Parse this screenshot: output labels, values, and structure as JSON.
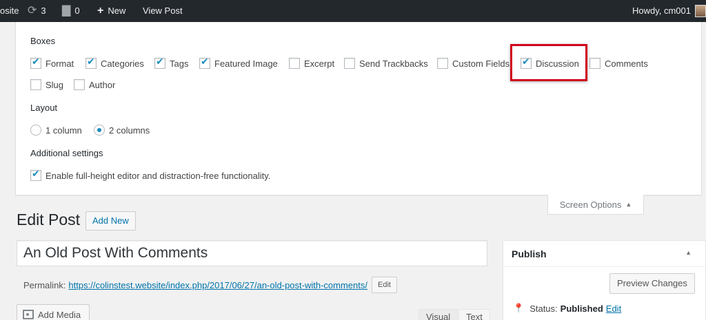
{
  "adminbar": {
    "site_label": "osite",
    "updates_count": "3",
    "comments_count": "0",
    "new_label": "New",
    "view_post_label": "View Post",
    "howdy": "Howdy, cm001"
  },
  "screen_options": {
    "boxes_title": "Boxes",
    "boxes": [
      {
        "label": "Format",
        "checked": true
      },
      {
        "label": "Categories",
        "checked": true
      },
      {
        "label": "Tags",
        "checked": true
      },
      {
        "label": "Featured Image",
        "checked": true
      },
      {
        "label": "Excerpt",
        "checked": false
      },
      {
        "label": "Send Trackbacks",
        "checked": false
      },
      {
        "label": "Custom Fields",
        "checked": false
      },
      {
        "label": "Discussion",
        "checked": true
      },
      {
        "label": "Comments",
        "checked": false
      },
      {
        "label": "Slug",
        "checked": false
      },
      {
        "label": "Author",
        "checked": false
      }
    ],
    "layout_title": "Layout",
    "layout_options": [
      {
        "label": "1 column",
        "checked": false
      },
      {
        "label": "2 columns",
        "checked": true
      }
    ],
    "additional_title": "Additional settings",
    "additional_option": {
      "label": "Enable full-height editor and distraction-free functionality.",
      "checked": true
    },
    "tab_label": "Screen Options",
    "highlight_color": "#d0021b",
    "accent_color": "#1e8cbe"
  },
  "edit": {
    "page_title": "Edit Post",
    "add_new_label": "Add New",
    "post_title": "An Old Post With Comments",
    "permalink_label": "Permalink:",
    "permalink_url": "https://colinstest.website/index.php/2017/06/27/an-old-post-with-comments/",
    "permalink_edit": "Edit",
    "add_media_label": "Add Media",
    "visual_tab": "Visual",
    "text_tab": "Text"
  },
  "publish": {
    "title": "Publish",
    "preview_label": "Preview Changes",
    "status_label": "Status:",
    "status_value": "Published",
    "status_edit": "Edit"
  }
}
